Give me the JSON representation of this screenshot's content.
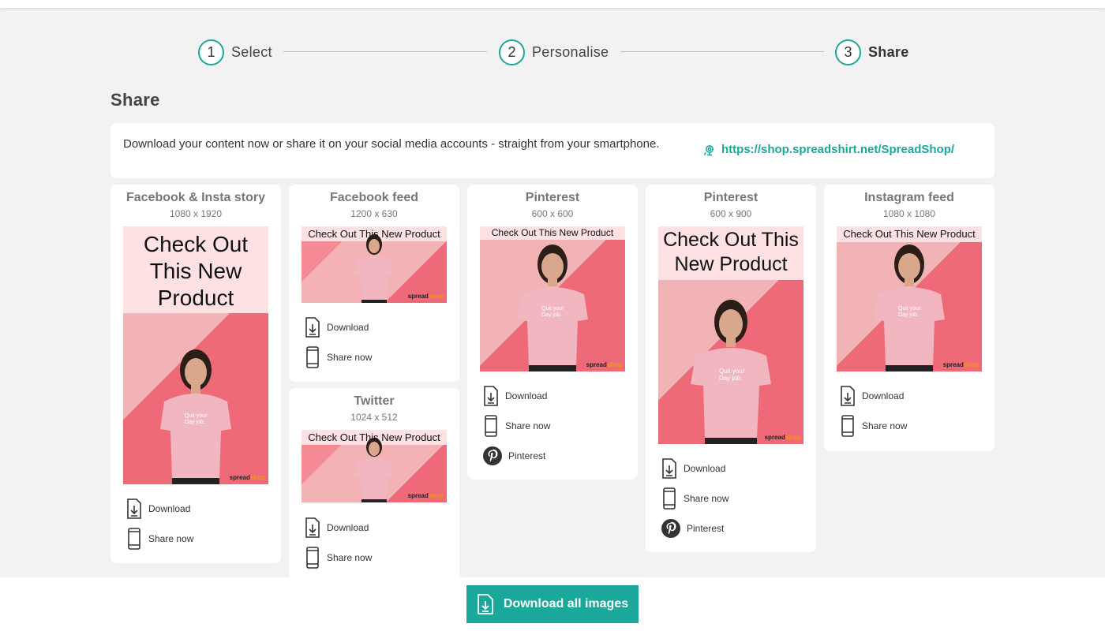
{
  "steps": [
    {
      "num": "1",
      "label": "Select"
    },
    {
      "num": "2",
      "label": "Personalise"
    },
    {
      "num": "3",
      "label": "Share"
    }
  ],
  "section_title": "Share",
  "info": {
    "text": "Download your content now or share it on your social media accounts - straight from your smartphone.",
    "link": "https://shop.spreadshirt.net/SpreadShop/"
  },
  "image_banner": "Check Out This New Product",
  "shirt_text": "Quit your Day job.",
  "brand": {
    "a": "spread",
    "b": "shop"
  },
  "actions": {
    "download": "Download",
    "share": "Share now",
    "pinterest": "Pinterest"
  },
  "cards": [
    {
      "title": "Facebook & Insta story",
      "dims": "1080 x 1920"
    },
    {
      "title": "Facebook feed",
      "dims": "1200 x 630"
    },
    {
      "title": "Twitter",
      "dims": "1024 x 512"
    },
    {
      "title": "Pinterest",
      "dims": "600 x 600"
    },
    {
      "title": "Pinterest",
      "dims": "600 x 900"
    },
    {
      "title": "Instagram feed",
      "dims": "1080 x 1080"
    }
  ],
  "download_all": "Download all images",
  "colors": {
    "accent": "#1aa89a",
    "pink_light": "#f2b3b6",
    "pink_dark": "#ee6a78"
  },
  "icons": [
    "download-icon",
    "phone-icon",
    "pinterest-icon",
    "link-icon"
  ]
}
